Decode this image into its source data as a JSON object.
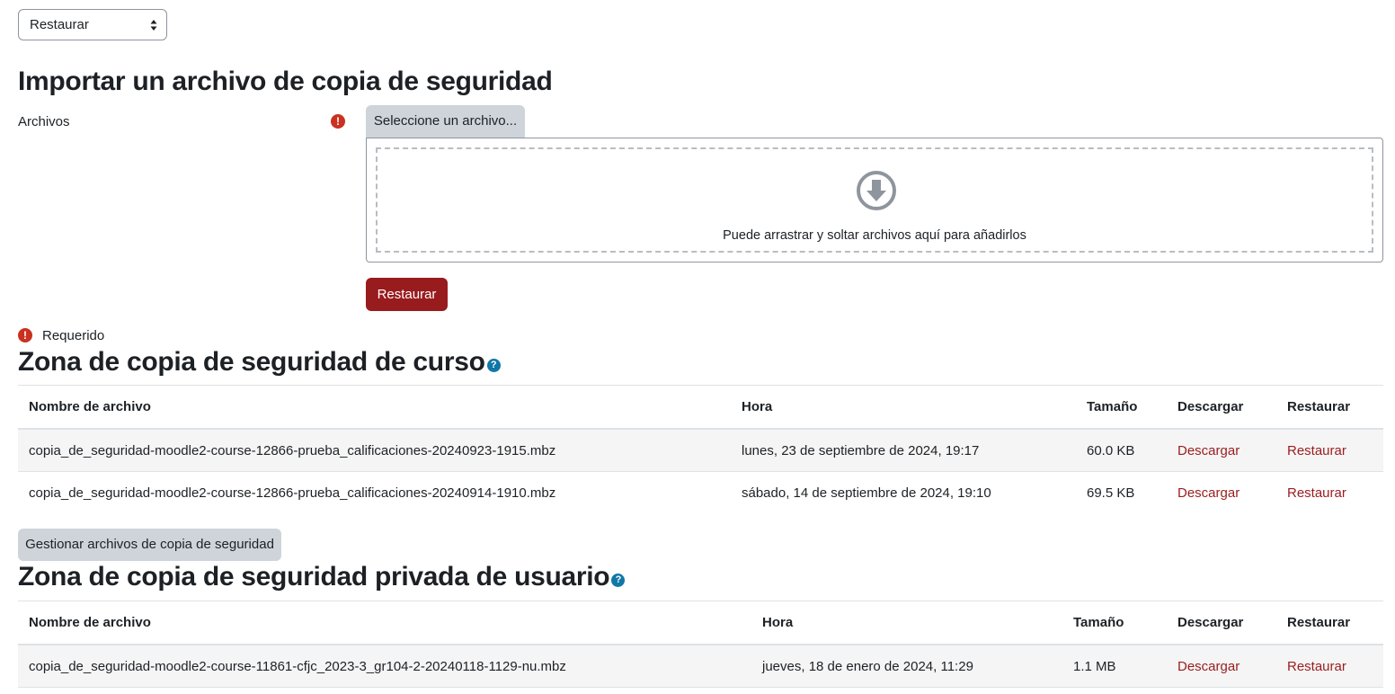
{
  "select": {
    "value": "Restaurar"
  },
  "import": {
    "title": "Importar un archivo de copia de seguridad",
    "files_label": "Archivos",
    "choose_button": "Seleccione un archivo...",
    "dropzone_text": "Puede arrastrar y soltar archivos aquí para añadirlos",
    "restore_button": "Restaurar",
    "required_legend": "Requerido"
  },
  "course_zone": {
    "title": "Zona de copia de seguridad de curso",
    "headers": [
      "Nombre de archivo",
      "Hora",
      "Tamaño",
      "Descargar",
      "Restaurar"
    ],
    "rows": [
      {
        "name": "copia_de_seguridad-moodle2-course-12866-prueba_calificaciones-20240923-1915.mbz",
        "time": "lunes, 23 de septiembre de 2024, 19:17",
        "size": "60.0 KB",
        "download": "Descargar",
        "restore": "Restaurar"
      },
      {
        "name": "copia_de_seguridad-moodle2-course-12866-prueba_calificaciones-20240914-1910.mbz",
        "time": "sábado, 14 de septiembre de 2024, 19:10",
        "size": "69.5 KB",
        "download": "Descargar",
        "restore": "Restaurar"
      }
    ],
    "manage_button": "Gestionar archivos de copia de seguridad"
  },
  "user_zone": {
    "title": "Zona de copia de seguridad privada de usuario",
    "headers": [
      "Nombre de archivo",
      "Hora",
      "Tamaño",
      "Descargar",
      "Restaurar"
    ],
    "rows": [
      {
        "name": "copia_de_seguridad-moodle2-course-11861-cfjc_2023-3_gr104-2-20240118-1129-nu.mbz",
        "time": "jueves, 18 de enero de 2024, 11:29",
        "size": "1.1 MB",
        "download": "Descargar",
        "restore": "Restaurar"
      }
    ]
  },
  "icons": {
    "required": "exclamation-circle-icon",
    "help": "question-circle-icon",
    "dropzone": "arrow-circle-down-icon",
    "select": "sort-arrows-icon"
  },
  "colors": {
    "primary": "#981b1e",
    "link": "#9a1c1e",
    "help": "#1177a7",
    "required": "#ca3120"
  }
}
